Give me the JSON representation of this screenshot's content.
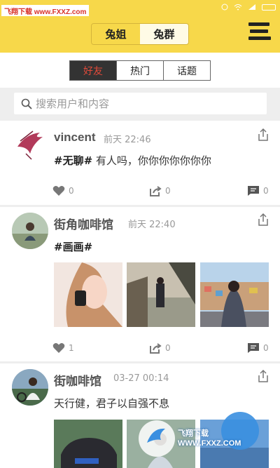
{
  "watermark": "飞翔下载 www.FXXZ.com",
  "status_bar": {
    "icons": [
      "alarm-icon",
      "wifi-icon",
      "signal-icon",
      "battery-icon"
    ]
  },
  "header": {
    "tabs": [
      "兔姐",
      "兔群"
    ],
    "active_tab": "兔姐"
  },
  "sub_tabs": {
    "items": [
      "好友",
      "热门",
      "话题"
    ],
    "active": "好友"
  },
  "search": {
    "placeholder": "搜索用户和内容"
  },
  "posts": [
    {
      "author": "vincent",
      "time": "前天 22:46",
      "tag": "#无聊#",
      "text": " 有人吗，你你你你你你你",
      "likes": "0",
      "shares": "0",
      "comments": "0",
      "images": []
    },
    {
      "author": "街角咖啡馆",
      "time": "前天 22:40",
      "tag": "#画画#",
      "text": "",
      "likes": "1",
      "shares": "0",
      "comments": "0",
      "images": [
        "girl-with-phone-photo",
        "person-walking-photo",
        "girl-overlooking-city-photo"
      ]
    },
    {
      "author": "街咖啡馆",
      "time": "03-27 00:14",
      "tag": "",
      "text": "天行健，君子以自强不息",
      "images": [
        "car-photo",
        "person-photo",
        "blue-photo"
      ]
    }
  ],
  "overlay_watermark": "飞翔下载 WWW.FXXZ.COM",
  "colors": {
    "header": "#f7d84a",
    "active_tab_bg": "#333333",
    "active_tab_text": "#e04a3a"
  }
}
